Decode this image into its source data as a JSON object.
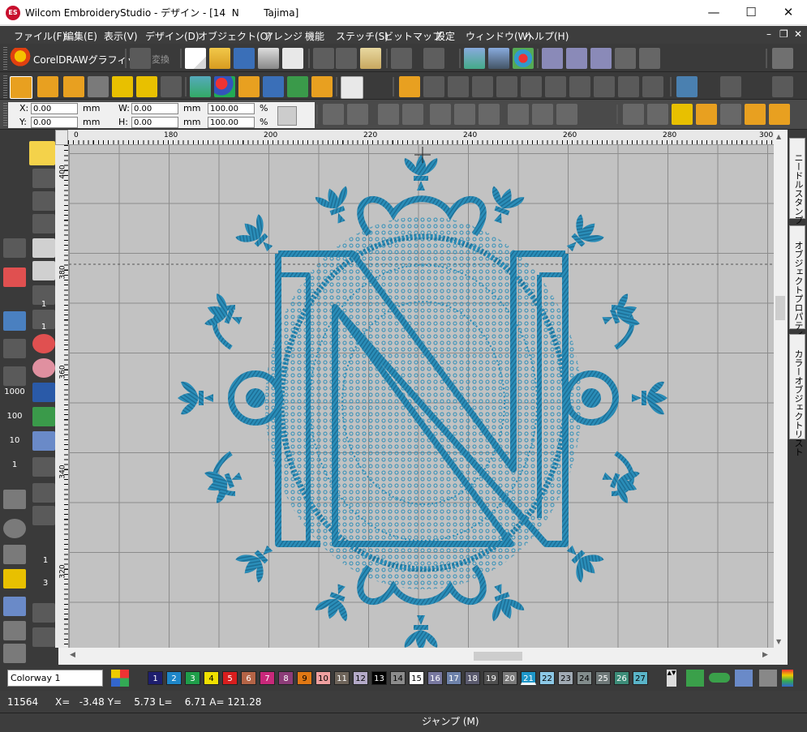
{
  "title_bar": {
    "logo": "ES",
    "title": "Wilcom EmbroideryStudio - デザイン - [14  N        Tajima]",
    "minimize": "—",
    "maximize": "☐",
    "close": "✕"
  },
  "menu": [
    "ファイル(F)",
    "編集(E)",
    "表示(V)",
    "デザイン(D)",
    "オブジェクト(O)",
    "アレンジ",
    "機能",
    "ステッチ(S)",
    "ビットマップ",
    "設定",
    "ウィンドウ(W)",
    "ヘルプ(H)"
  ],
  "menu_window_controls": {
    "minimize": "–",
    "restore": "❐",
    "close": "✕"
  },
  "toolbar1": {
    "coreldraw_label": "CorelDRAWグラフィック",
    "convert_label": "変換"
  },
  "props": {
    "x_label": "X:",
    "x_value": "0.00",
    "y_label": "Y:",
    "y_value": "0.00",
    "w_label": "W:",
    "w_value": "0.00",
    "h_label": "H:",
    "h_value": "0.00",
    "unit": "mm",
    "scale_w": "100.00",
    "scale_h": "100.00",
    "percent": "%"
  },
  "left_tools_numbers": [
    "1",
    "1",
    "1000",
    "100",
    "10",
    "1",
    "1",
    "3"
  ],
  "hruler_ticks": [
    "0",
    "180",
    "200",
    "220",
    "240",
    "260",
    "280",
    "300"
  ],
  "vruler_ticks": [
    "400",
    "380",
    "360",
    "340",
    "320"
  ],
  "right_dock_tabs": [
    "ニードルスタンプ",
    "オブジェクトプロパティ",
    "カラーオブジェクトリスト"
  ],
  "colorway": {
    "label": "Colorway 1"
  },
  "swatches": [
    {
      "n": "1",
      "bg": "#1e1e6e",
      "fg": "#ffffff"
    },
    {
      "n": "2",
      "bg": "#1e86c8",
      "fg": "#ffffff"
    },
    {
      "n": "3",
      "bg": "#1f9e4a",
      "fg": "#ffffff"
    },
    {
      "n": "4",
      "bg": "#f0e000",
      "fg": "#000000"
    },
    {
      "n": "5",
      "bg": "#d81e1e",
      "fg": "#ffffff"
    },
    {
      "n": "6",
      "bg": "#b46446",
      "fg": "#ffffff"
    },
    {
      "n": "7",
      "bg": "#c8287a",
      "fg": "#ffffff"
    },
    {
      "n": "8",
      "bg": "#8c3c78",
      "fg": "#ffffff"
    },
    {
      "n": "9",
      "bg": "#e07814",
      "fg": "#000000"
    },
    {
      "n": "10",
      "bg": "#f0a0a0",
      "fg": "#000000"
    },
    {
      "n": "11",
      "bg": "#6e645a",
      "fg": "#ffffff"
    },
    {
      "n": "12",
      "bg": "#b4aac8",
      "fg": "#000000"
    },
    {
      "n": "13",
      "bg": "#000000",
      "fg": "#ffffff"
    },
    {
      "n": "14",
      "bg": "#8c8c8c",
      "fg": "#000000"
    },
    {
      "n": "15",
      "bg": "#ffffff",
      "fg": "#000000"
    },
    {
      "n": "16",
      "bg": "#7878a0",
      "fg": "#ffffff"
    },
    {
      "n": "17",
      "bg": "#6e82aa",
      "fg": "#ffffff"
    },
    {
      "n": "18",
      "bg": "#5a5a6e",
      "fg": "#ffffff"
    },
    {
      "n": "19",
      "bg": "#505050",
      "fg": "#ffffff"
    },
    {
      "n": "20",
      "bg": "#7a7a7a",
      "fg": "#ffffff"
    },
    {
      "n": "21",
      "bg": "#1e96c8",
      "fg": "#ffffff"
    },
    {
      "n": "22",
      "bg": "#8cc8e6",
      "fg": "#000000"
    },
    {
      "n": "23",
      "bg": "#a0aab4",
      "fg": "#000000"
    },
    {
      "n": "24",
      "bg": "#828c8c",
      "fg": "#000000"
    },
    {
      "n": "25",
      "bg": "#6e7878",
      "fg": "#ffffff"
    },
    {
      "n": "26",
      "bg": "#3c8c78",
      "fg": "#ffffff"
    },
    {
      "n": "27",
      "bg": "#5ab4c8",
      "fg": "#000000"
    }
  ],
  "status": {
    "stitch_count": "11564",
    "coords": "X=   -3.48 Y=    5.73 L=    6.71 A= 121.28",
    "mode": "ジャンプ (M)"
  },
  "colors": {
    "embroidery": "#2a8db8",
    "embroidery_dark": "#1b6a91",
    "accent": "#e8c000"
  }
}
